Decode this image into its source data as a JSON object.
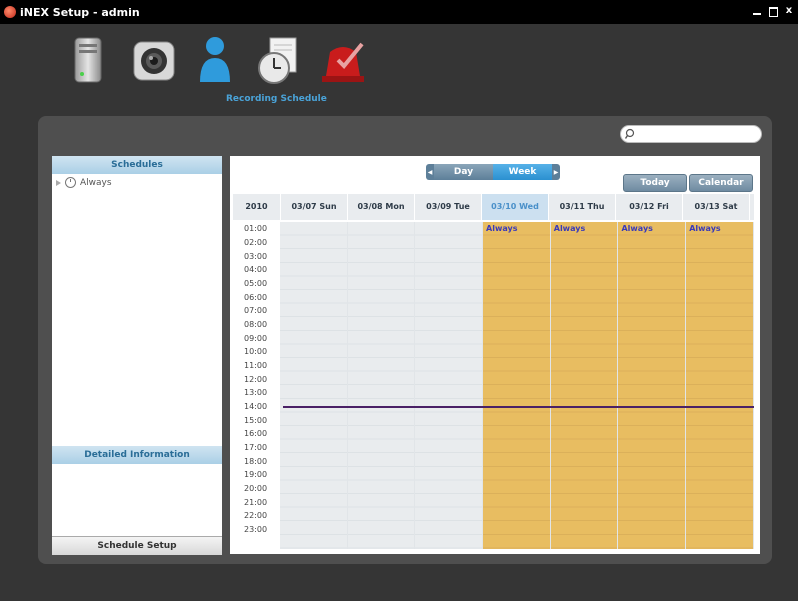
{
  "window": {
    "title": "iNEX Setup - admin",
    "close_label": "x"
  },
  "toolbar": {
    "items": [
      {
        "name": "device",
        "icon": "server-icon"
      },
      {
        "name": "camera",
        "icon": "camera-icon"
      },
      {
        "name": "user",
        "icon": "user-icon"
      },
      {
        "name": "recording-schedule",
        "icon": "clock-document-icon"
      },
      {
        "name": "alarm",
        "icon": "alarm-icon"
      }
    ],
    "active_label": "Recording Schedule"
  },
  "sidebar": {
    "schedules_header": "Schedules",
    "tree": [
      {
        "label": "Always"
      }
    ],
    "detail_header": "Detailed Information",
    "setup_button": "Schedule Setup"
  },
  "calendar": {
    "view_buttons": {
      "day": "Day",
      "week": "Week"
    },
    "today_button": "Today",
    "calendar_button": "Calendar",
    "year": "2010",
    "days": [
      {
        "label": "03/07 Sun",
        "event": ""
      },
      {
        "label": "03/08 Mon",
        "event": ""
      },
      {
        "label": "03/09 Tue",
        "event": ""
      },
      {
        "label": "03/10 Wed",
        "event": "Always",
        "active": true
      },
      {
        "label": "03/11 Thu",
        "event": "Always"
      },
      {
        "label": "03/12 Fri",
        "event": "Always"
      },
      {
        "label": "03/13 Sat",
        "event": "Always"
      }
    ],
    "hours": [
      "01:00",
      "02:00",
      "03:00",
      "04:00",
      "05:00",
      "06:00",
      "07:00",
      "08:00",
      "09:00",
      "10:00",
      "11:00",
      "12:00",
      "13:00",
      "14:00",
      "15:00",
      "16:00",
      "17:00",
      "18:00",
      "19:00",
      "20:00",
      "21:00",
      "22:00",
      "23:00"
    ]
  },
  "colors": {
    "accent_blue": "#2b90d0",
    "event_fill": "#e8bd61",
    "now_line": "#4a2166"
  }
}
